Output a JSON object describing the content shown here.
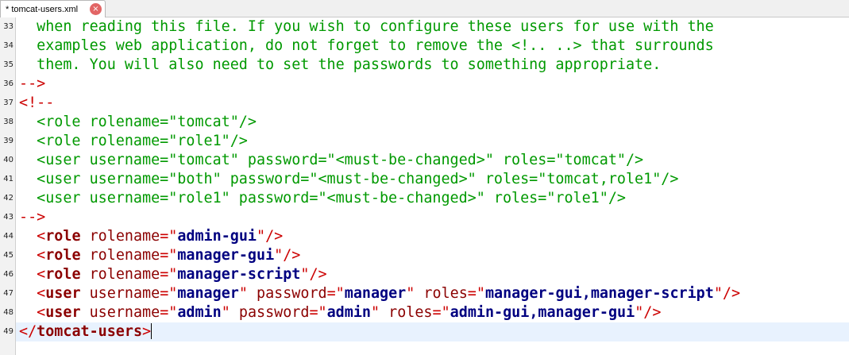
{
  "tab": {
    "title": "* tomcat-users.xml",
    "close_glyph": "×"
  },
  "lines": [
    {
      "n": "33",
      "text": "  when reading this file. If you wish to configure these users for use with the"
    },
    {
      "n": "34",
      "text": "  examples web application, do not forget to remove the <!.. ..> that surrounds"
    },
    {
      "n": "35",
      "text": "  them. You will also need to set the passwords to something appropriate."
    },
    {
      "n": "36",
      "text": "-->"
    },
    {
      "n": "37",
      "text": "<!--"
    },
    {
      "n": "38",
      "text": "  <role rolename=\"tomcat\"/>"
    },
    {
      "n": "39",
      "text": "  <role rolename=\"role1\"/>"
    },
    {
      "n": "40",
      "text": "  <user username=\"tomcat\" password=\"<must-be-changed>\" roles=\"tomcat\"/>"
    },
    {
      "n": "41",
      "text": "  <user username=\"both\" password=\"<must-be-changed>\" roles=\"tomcat,role1\"/>"
    },
    {
      "n": "42",
      "text": "  <user username=\"role1\" password=\"<must-be-changed>\" roles=\"role1\"/>"
    },
    {
      "n": "43",
      "text": "-->"
    },
    {
      "n": "44",
      "tag": "role",
      "attrs": [
        {
          "name": "rolename",
          "value": "admin-gui"
        }
      ]
    },
    {
      "n": "45",
      "tag": "role",
      "attrs": [
        {
          "name": "rolename",
          "value": "manager-gui"
        }
      ]
    },
    {
      "n": "46",
      "tag": "role",
      "attrs": [
        {
          "name": "rolename",
          "value": "manager-script"
        }
      ]
    },
    {
      "n": "47",
      "tag": "user",
      "attrs": [
        {
          "name": "username",
          "value": "manager"
        },
        {
          "name": "password",
          "value": "manager"
        },
        {
          "name": "roles",
          "value": "manager-gui,manager-script"
        }
      ]
    },
    {
      "n": "48",
      "tag": "user",
      "attrs": [
        {
          "name": "username",
          "value": "admin"
        },
        {
          "name": "password",
          "value": "admin"
        },
        {
          "name": "roles",
          "value": "admin-gui,manager-gui"
        }
      ]
    },
    {
      "n": "49",
      "closing_tag": "tomcat-users",
      "current": true
    }
  ],
  "colors": {
    "comment": "#009900",
    "comment_delimiter": "#cc0000",
    "tag": "#8b0000",
    "attr_value": "#000080",
    "current_line": "#e8f2fe"
  }
}
